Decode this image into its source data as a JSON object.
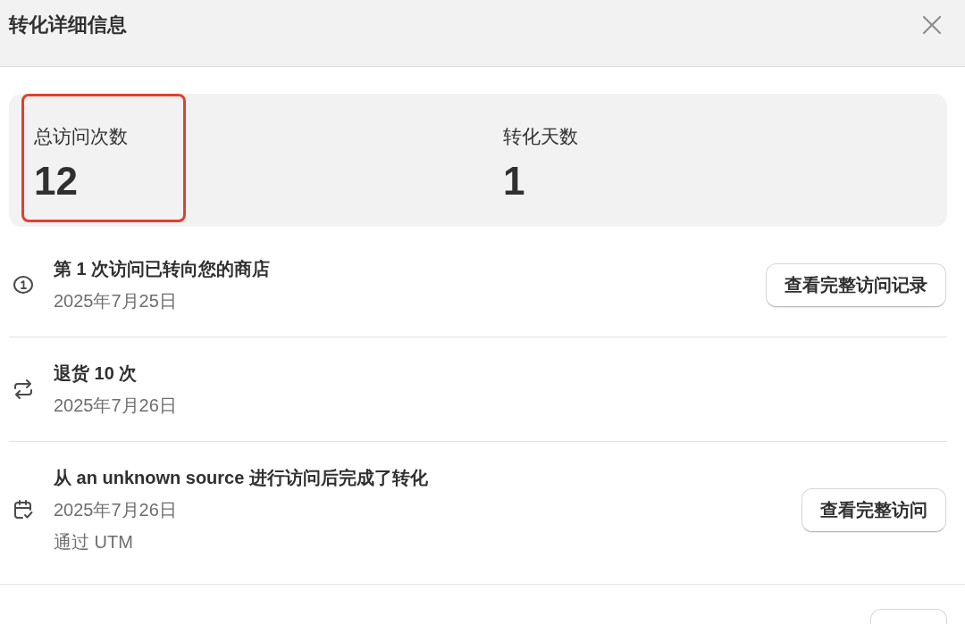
{
  "dialog": {
    "title": "转化详细信息"
  },
  "stats": [
    {
      "label": "总访问次数",
      "value": "12",
      "highlighted": true
    },
    {
      "label": "转化天数",
      "value": "1",
      "highlighted": false
    }
  ],
  "timeline": [
    {
      "kind": "visit",
      "title": "第 1 次访问已转向您的商店",
      "date": "2025年7月25日",
      "button": "查看完整访问记录"
    },
    {
      "kind": "return",
      "title": "退货 10 次",
      "date": "2025年7月26日"
    },
    {
      "kind": "conversion",
      "title": "从 an unknown source 进行访问后完成了转化",
      "date": "2025年7月26日",
      "note": "通过 UTM",
      "button": "查看完整访问"
    }
  ],
  "footer": {
    "buttons": [
      {
        "kind": "partial"
      }
    ]
  }
}
